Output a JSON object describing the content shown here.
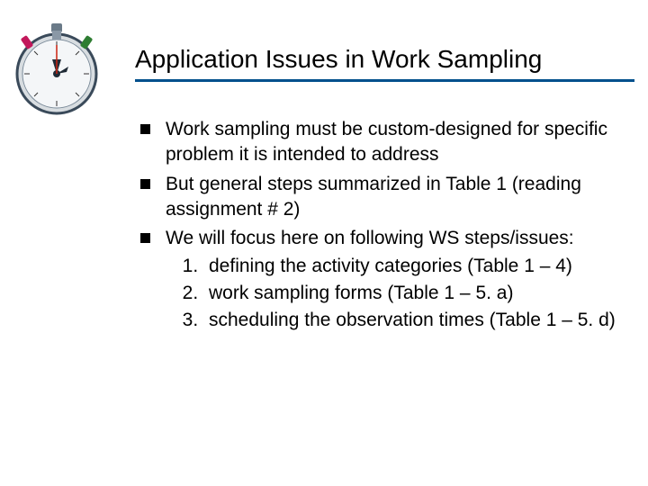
{
  "slide": {
    "title": "Application Issues in Work Sampling",
    "bullets": [
      {
        "text": "Work sampling must be custom-designed for specific problem it is intended to address"
      },
      {
        "text": "But general steps summarized in Table 1 (reading assignment # 2)"
      },
      {
        "text": "We will focus here on following WS steps/issues:",
        "sub": [
          "defining the activity categories (Table 1 – 4)",
          "work sampling forms (Table 1 – 5. a)",
          "scheduling the observation times (Table 1 – 5. d)"
        ]
      }
    ]
  },
  "icon": {
    "name": "stopwatch-icon"
  },
  "colors": {
    "rule": "#00508c"
  }
}
